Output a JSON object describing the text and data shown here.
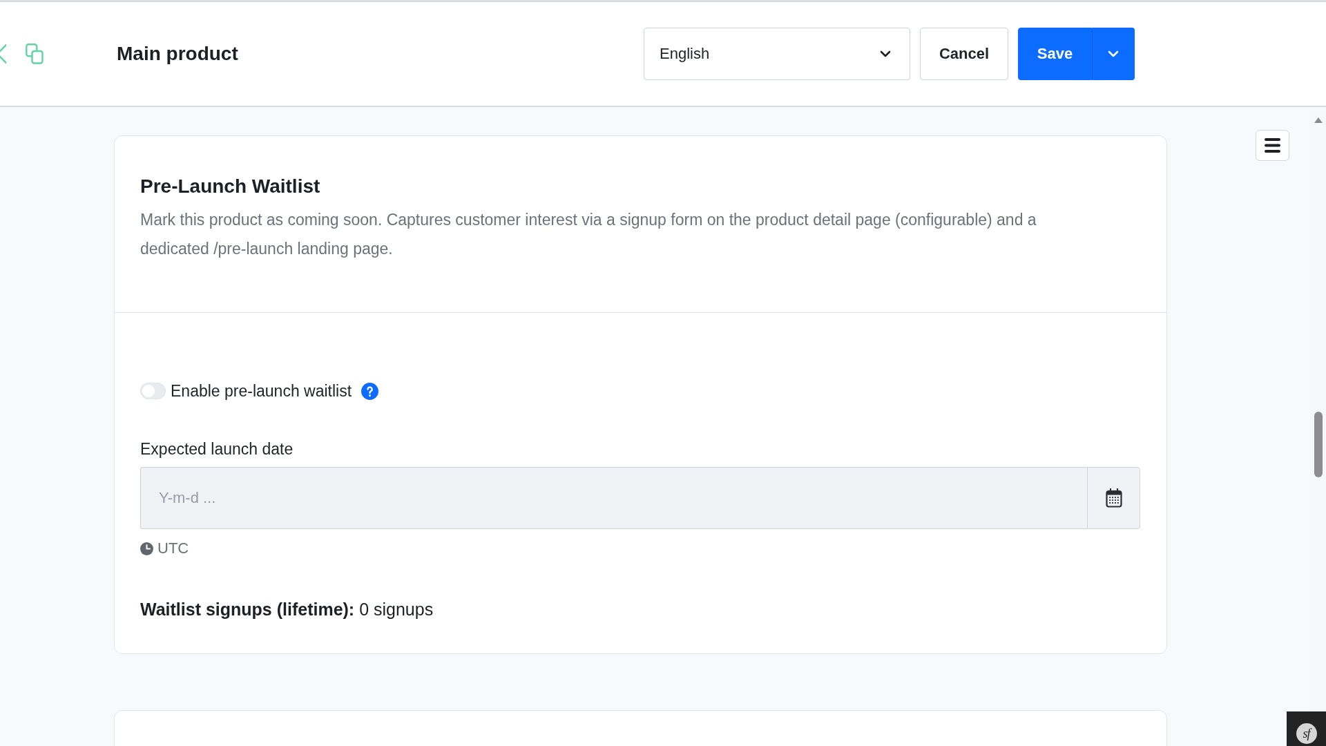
{
  "header": {
    "title": "Main product",
    "language_select": {
      "value": "English"
    },
    "cancel_button": "Cancel",
    "save_button": "Save"
  },
  "waitlist_card": {
    "title": "Pre-Launch Waitlist",
    "description": "Mark this product as coming soon. Captures customer interest via a signup form on the product detail page (configurable) and a dedicated /pre-launch landing page.",
    "enable_toggle": {
      "label": "Enable pre-launch waitlist",
      "on": false
    },
    "launch_date": {
      "label": "Expected launch date",
      "placeholder": "Y-m-d ...",
      "timezone": "UTC"
    },
    "signups": "**Waitlist signups (lifetime):** 0 signups"
  },
  "debug_toolbar": {
    "logo_text": "sf"
  }
}
